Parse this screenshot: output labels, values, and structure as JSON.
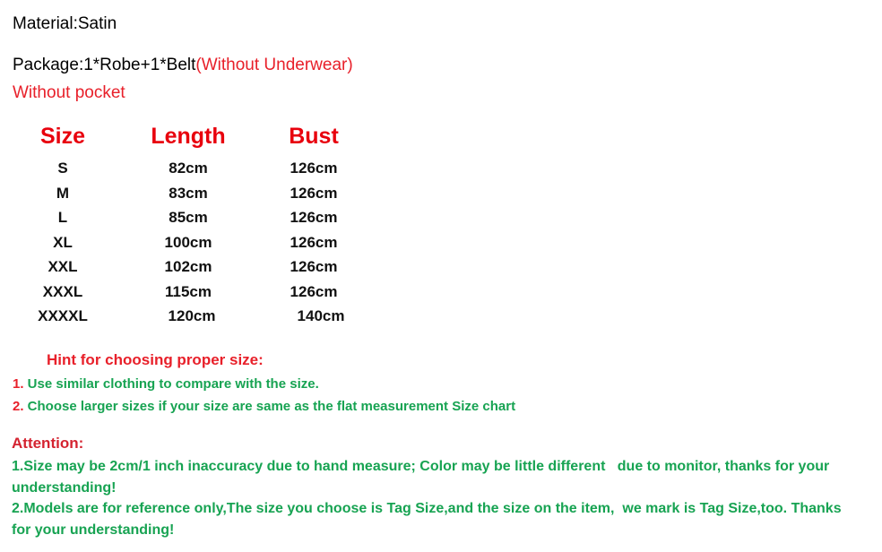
{
  "colors": {
    "red": "#e8202a",
    "red_header": "#e8000d",
    "red_attention": "#d42330",
    "green": "#17a352",
    "black": "#000000",
    "background": "#ffffff"
  },
  "info": {
    "material": "Material:Satin",
    "package_black": "Package:1*Robe+1*Belt",
    "package_red": "(Without Underwear)",
    "pocket": "Without pocket"
  },
  "size_chart": {
    "headers": {
      "size": "Size",
      "length": "Length",
      "bust": "Bust"
    },
    "rows": [
      {
        "size": "S",
        "length": "82cm",
        "bust": "126cm"
      },
      {
        "size": "M",
        "length": "83cm",
        "bust": "126cm"
      },
      {
        "size": "L",
        "length": "85cm",
        "bust": "126cm"
      },
      {
        "size": "XL",
        "length": "100cm",
        "bust": "126cm"
      },
      {
        "size": "XXL",
        "length": "102cm",
        "bust": "126cm"
      },
      {
        "size": "XXXL",
        "length": "115cm",
        "bust": "126cm"
      },
      {
        "size": "XXXXL",
        "length": "120cm",
        "bust": "140cm"
      }
    ]
  },
  "hint": {
    "title": "Hint for choosing proper size:",
    "items": [
      {
        "num": "1.",
        "text": " Use similar clothing to compare with the size."
      },
      {
        "num": "2.",
        "text": " Choose larger sizes if your size are same as the flat measurement Size chart"
      }
    ]
  },
  "attention": {
    "title": "Attention:",
    "lines": [
      "1.Size may be 2cm/1 inch inaccuracy due to hand measure; Color may be little different   due to monitor, thanks for your understanding!",
      "2.Models are for reference only,The size you choose is Tag Size,and the size on the item,  we mark is Tag Size,too. Thanks for your understanding!"
    ]
  }
}
